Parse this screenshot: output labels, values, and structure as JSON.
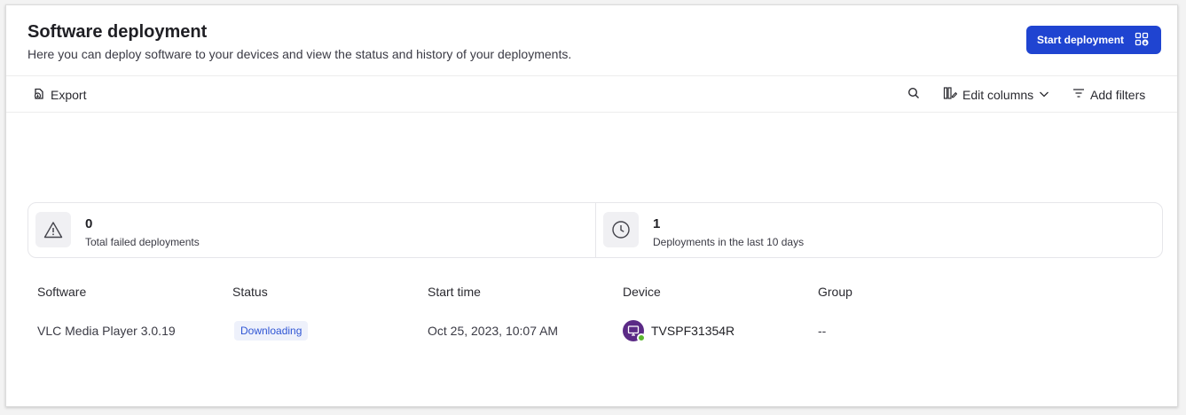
{
  "header": {
    "title": "Software deployment",
    "subtitle": "Here you can deploy software to your devices and view the status and history of your deployments.",
    "start_button": "Start deployment"
  },
  "toolbar": {
    "export": "Export",
    "edit_columns": "Edit columns",
    "add_filters": "Add filters"
  },
  "stats": [
    {
      "value": "0",
      "label": "Total failed deployments",
      "icon": "warning-icon"
    },
    {
      "value": "1",
      "label": "Deployments in the last 10 days",
      "icon": "clock-icon"
    }
  ],
  "table": {
    "columns": [
      "Software",
      "Status",
      "Start time",
      "Device",
      "Group"
    ],
    "rows": [
      {
        "software": "VLC Media Player 3.0.19",
        "status": "Downloading",
        "start_time": "Oct 25, 2023, 10:07 AM",
        "device": "TVSPF31354R",
        "group": "--"
      }
    ]
  },
  "colors": {
    "accent": "#1f44d1",
    "status_badge_bg": "#eef1fb",
    "status_badge_text": "#2f55d4",
    "device_avatar": "#5b2a86",
    "online_dot": "#5cb82e"
  }
}
